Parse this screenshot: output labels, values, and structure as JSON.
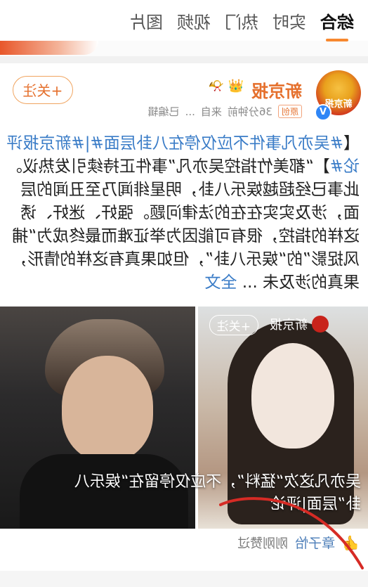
{
  "tabs": [
    {
      "label": "综合",
      "active": true
    },
    {
      "label": "实时",
      "active": false
    },
    {
      "label": "热门",
      "active": false
    },
    {
      "label": "视频",
      "active": false
    },
    {
      "label": "图片",
      "active": false
    }
  ],
  "post": {
    "author": "新京报",
    "avatar_text": "新京报",
    "time": "36分钟前",
    "source_prefix": "来自",
    "source": "...",
    "edited": "已编辑",
    "original_tag": "原创",
    "follow_label": "+关注",
    "lines": [
      {
        "hashtag": "#吴亦凡事件不应仅停在八卦层面#",
        "rest": "|#新京报评"
      },
      {
        "hashtag": "论#",
        "rest": "】“都美竹指控吴亦凡”事件正持续引发热议。"
      },
      {
        "hashtag": "",
        "rest": "此事已经超越娱乐八卦，明星绯闻乃至丑闻的层"
      },
      {
        "hashtag": "",
        "rest": "面，涉及实实在在的法律问题。强奸、迷奸、诱"
      },
      {
        "hashtag": "",
        "rest": "这样的指控，很有可能因为举证难而最终成为“捕"
      },
      {
        "hashtag": "",
        "rest": "风捉影”的“娱乐八卦”，但如果真有这样的情形，"
      },
      {
        "hashtag": "",
        "rest": "果真的涉及未 ..."
      }
    ],
    "fulltext_label": "全文",
    "image_logo": "新京报",
    "image_follow": "+关注",
    "image_caption_1": "吴亦凡这次“猛料”，不应仅停留在“娱乐八",
    "image_caption_2": "卦”层面|评论",
    "likes_user": "章子怡",
    "likes_time": "刚刚赞过",
    "colors": {
      "accent": "#f7882f",
      "link": "#3a7cc7",
      "name": "#e5702d"
    }
  }
}
